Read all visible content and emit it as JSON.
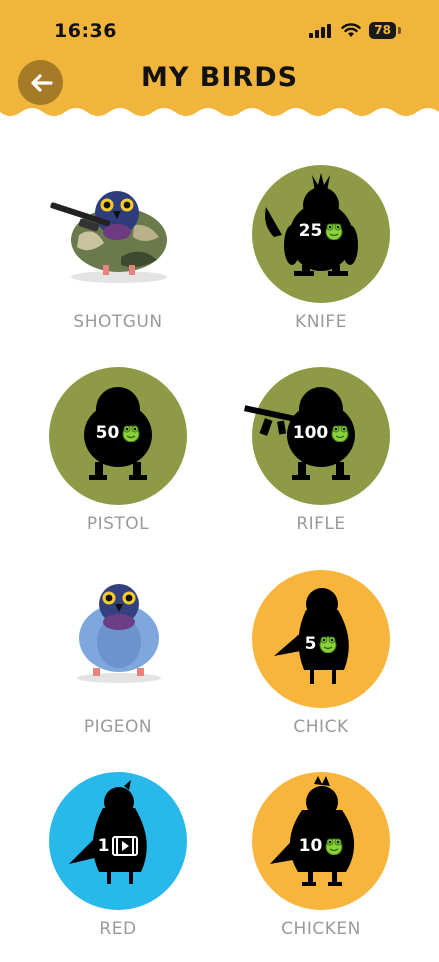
{
  "status_bar": {
    "time": "16:36",
    "battery": "78"
  },
  "header": {
    "title": "MY BIRDS",
    "color": "#f2b53b"
  },
  "colors": {
    "olive": "#8e9a45",
    "orange": "#f7b53b",
    "blue": "#28b8ea",
    "label": "#9a9a9a"
  },
  "birds": [
    {
      "name": "SHOTGUN",
      "owned": true
    },
    {
      "name": "KNIFE",
      "owned": false,
      "price": "25",
      "currency": "frog-coin-icon"
    },
    {
      "name": "PISTOL",
      "owned": false,
      "price": "50",
      "currency": "frog-coin-icon"
    },
    {
      "name": "RIFLE",
      "owned": false,
      "price": "100",
      "currency": "frog-coin-icon"
    },
    {
      "name": "PIGEON",
      "owned": true
    },
    {
      "name": "CHICK",
      "owned": false,
      "price": "5",
      "currency": "frog-coin-icon"
    },
    {
      "name": "RED",
      "owned": false,
      "price": "1",
      "currency": "video-ad-icon"
    },
    {
      "name": "CHICKEN",
      "owned": false,
      "price": "10",
      "currency": "frog-coin-icon"
    }
  ]
}
